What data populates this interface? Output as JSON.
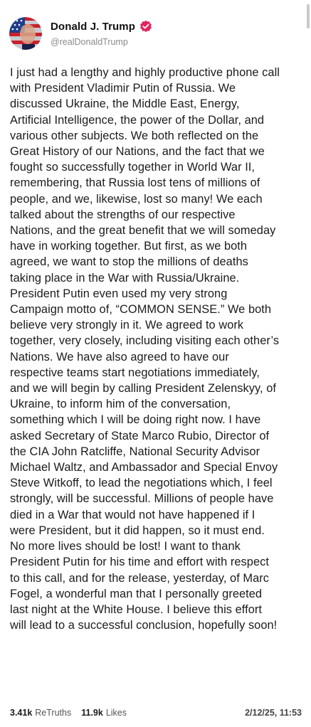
{
  "post": {
    "author": {
      "display_name": "Donald J. Trump",
      "handle": "@realDonaldTrump",
      "verified_icon": "verified-badge-icon",
      "verified_color": "#e0245e"
    },
    "text": "I just had a lengthy and highly productive phone call\nwith President Vladimir Putin of Russia. We\ndiscussed Ukraine, the Middle East, Energy,\nArtificial Intelligence, the power of the Dollar, and\nvarious other subjects. We both reflected on the\nGreat History of our Nations, and the fact that we\nfought so successfully together in World War II,\nremembering, that Russia lost tens of millions of\npeople, and we, likewise, lost so many! We each\ntalked about the strengths of our respective\nNations, and the great benefit that we will someday\nhave in working together. But first, as we both\nagreed, we want to stop the millions of deaths\ntaking place in the War with Russia/Ukraine.\nPresident Putin even used my very strong\nCampaign motto of, “COMMON SENSE.” We both\nbelieve very strongly in it. We agreed to work\ntogether, very closely, including visiting each other’s\nNations. We have also agreed to have our\nrespective teams start negotiations immediately,\nand we will begin by calling President Zelenskyy, of\nUkraine, to inform him of the conversation,\nsomething which I will be doing right now. I have\nasked Secretary of State Marco Rubio, Director of\nthe CIA John Ratcliffe, National Security Advisor\nMichael Waltz, and Ambassador and Special Envoy\nSteve Witkoff, to lead the negotiations which, I feel\nstrongly, will be successful. Millions of people have\ndied in a War that would not have happened if I\nwere President, but it did happen, so it must end.\nNo more lives should be lost! I want to thank\nPresident Putin for his time and effort with respect\nto this call, and for the release, yesterday, of Marc\nFogel, a wonderful man that I personally greeted\nlast night at the White House. I believe this effort\nwill lead to a successful conclusion, hopefully soon!",
    "stats": {
      "retruths_count": "3.41k",
      "retruths_label": "ReTruths",
      "likes_count": "11.9k",
      "likes_label": "Likes"
    },
    "timestamp": "2/12/25, 11:53"
  }
}
